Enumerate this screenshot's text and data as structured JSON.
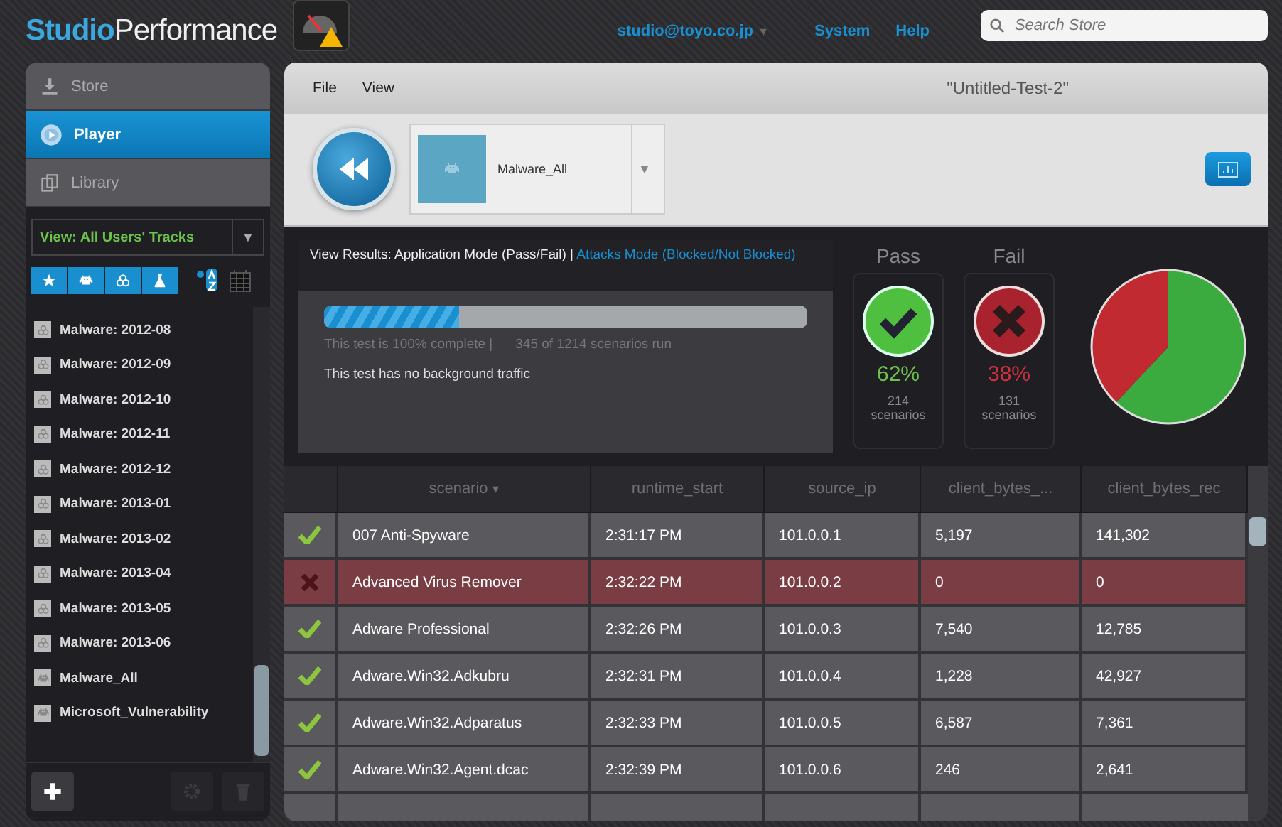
{
  "header": {
    "logo": {
      "part_1": "Studio",
      "part_2": "Performance"
    },
    "user": "studio@toyo.co.jp",
    "user_caret": "▼",
    "links": [
      "System",
      "Help"
    ],
    "search": {
      "placeholder": "Search Store"
    }
  },
  "sidebar": {
    "nav": [
      {
        "label": "Store",
        "kind": "store",
        "selected": false
      },
      {
        "label": "Player",
        "kind": "player",
        "selected": true
      },
      {
        "label": "Library",
        "kind": "library",
        "selected": false
      }
    ],
    "view_select": {
      "value": "View: All Users' Tracks",
      "caret": "▼"
    },
    "filters": [
      {
        "kind": "star"
      },
      {
        "kind": "invader"
      },
      {
        "kind": "biohazard"
      },
      {
        "kind": "flask"
      }
    ],
    "tracks": [
      {
        "label": "Malware: 2012-08",
        "kind": "biohazard"
      },
      {
        "label": "Malware: 2012-09",
        "kind": "biohazard"
      },
      {
        "label": "Malware: 2012-10",
        "kind": "biohazard"
      },
      {
        "label": "Malware: 2012-11",
        "kind": "biohazard"
      },
      {
        "label": "Malware: 2012-12",
        "kind": "biohazard"
      },
      {
        "label": "Malware: 2013-01",
        "kind": "biohazard"
      },
      {
        "label": "Malware: 2013-02",
        "kind": "biohazard"
      },
      {
        "label": "Malware: 2013-04",
        "kind": "biohazard"
      },
      {
        "label": "Malware: 2013-05",
        "kind": "biohazard"
      },
      {
        "label": "Malware: 2013-06",
        "kind": "biohazard"
      },
      {
        "label": "Malware_All",
        "kind": "invader"
      },
      {
        "label": "Microsoft_Vulnerability",
        "kind": "invader"
      }
    ],
    "bottom_buttons": [
      {
        "kind": "add",
        "disabled": false
      },
      {
        "kind": "settings",
        "disabled": true
      },
      {
        "kind": "delete",
        "disabled": true
      }
    ]
  },
  "main": {
    "menu": [
      "File",
      "View"
    ],
    "title": "\"Untitled-Test-2\"",
    "track": {
      "label": "Malware_All",
      "caret": "▼"
    },
    "results": {
      "heading": "View Results: Application Mode (Pass/Fail) |",
      "heading_link": "Attacks Mode (Blocked/Not Blocked)",
      "progress": {
        "level": 0.28
      },
      "complete": "This test is 100% complete |",
      "scenarios_run": "345 of 1214 scenarios run",
      "note": "This test has no background traffic",
      "pass": {
        "label": "Pass",
        "percent": "62%",
        "count": "214",
        "unit": "scenarios"
      },
      "fail": {
        "label": "Fail",
        "percent": "38%",
        "count": "131",
        "unit": "scenarios"
      },
      "chart_data": {
        "type": "pie",
        "series": [
          {
            "values": [
              62,
              38
            ]
          }
        ],
        "colors": [
          "#3cab3f",
          "#c22a32"
        ]
      }
    },
    "table": {
      "sort_marker": "▾",
      "columns": [
        "scenario",
        "runtime_start",
        "source_ip",
        "client_bytes_...",
        "client_bytes_rec"
      ],
      "rows": [
        {
          "passed": true,
          "cells": [
            "007 Anti-Spyware",
            "2:31:17 PM",
            "101.0.0.1",
            "5,197",
            "141,302"
          ]
        },
        {
          "passed": false,
          "cells": [
            "Advanced Virus Remover",
            "2:32:22 PM",
            "101.0.0.2",
            "0",
            "0"
          ]
        },
        {
          "passed": true,
          "cells": [
            "Adware Professional",
            "2:32:26 PM",
            "101.0.0.3",
            "7,540",
            "12,785"
          ]
        },
        {
          "passed": true,
          "cells": [
            "Adware.Win32.Adkubru",
            "2:32:31 PM",
            "101.0.0.4",
            "1,228",
            "42,927"
          ]
        },
        {
          "passed": true,
          "cells": [
            "Adware.Win32.Adparatus",
            "2:32:33 PM",
            "101.0.0.5",
            "6,587",
            "7,361"
          ]
        },
        {
          "passed": true,
          "cells": [
            "Adware.Win32.Agent.dcac",
            "2:32:39 PM",
            "101.0.0.6",
            "246",
            "2,641"
          ]
        }
      ]
    }
  }
}
